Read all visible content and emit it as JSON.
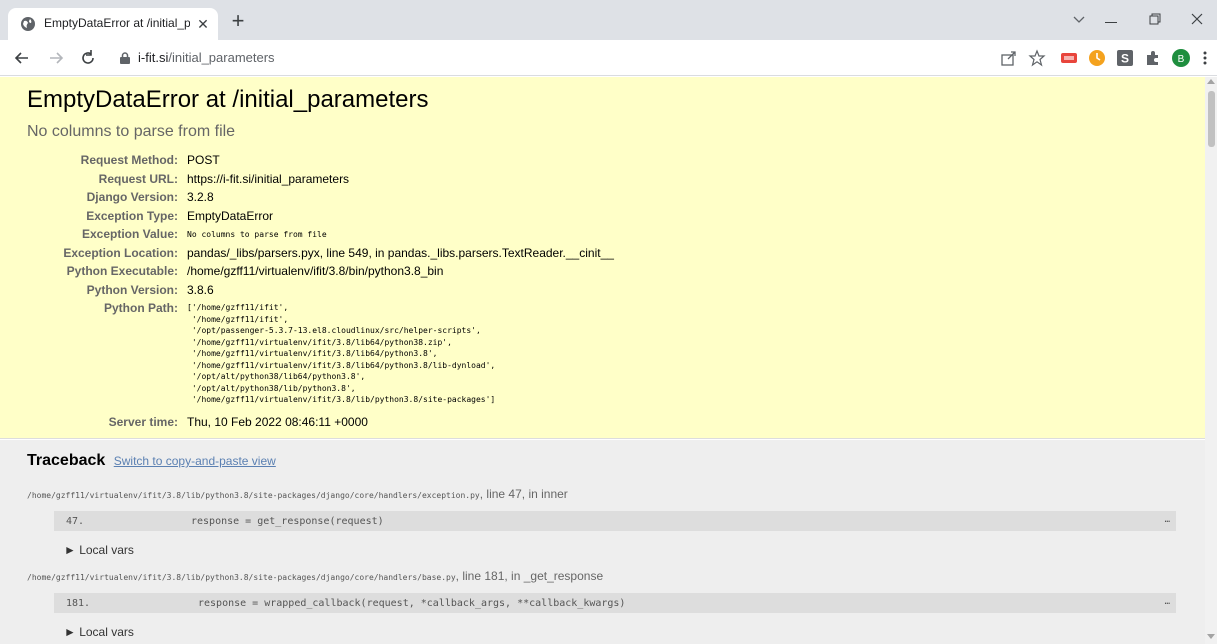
{
  "browser": {
    "tab_title": "EmptyDataError at /initial_param",
    "url_host": "i-fit.si",
    "url_path": "/initial_parameters",
    "profile_initial": "B"
  },
  "error": {
    "title": "EmptyDataError at /initial_parameters",
    "subtitle": "No columns to parse from file"
  },
  "meta": [
    {
      "key": "Request Method:",
      "value": "POST"
    },
    {
      "key": "Request URL:",
      "value": "https://i-fit.si/initial_parameters"
    },
    {
      "key": "Django Version:",
      "value": "3.2.8"
    },
    {
      "key": "Exception Type:",
      "value": "EmptyDataError"
    },
    {
      "key": "Exception Value:",
      "value": "No columns to parse from file"
    },
    {
      "key": "Exception Location:",
      "value": "pandas/_libs/parsers.pyx, line 549, in pandas._libs.parsers.TextReader.__cinit__"
    },
    {
      "key": "Python Executable:",
      "value": "/home/gzff11/virtualenv/ifit/3.8/bin/python3.8_bin"
    },
    {
      "key": "Python Version:",
      "value": "3.8.6"
    },
    {
      "key": "Python Path:",
      "value": ""
    },
    {
      "key": "Server time:",
      "value": "Thu, 10 Feb 2022 08:46:11 +0000"
    }
  ],
  "python_path": [
    "['/home/gzff11/ifit',",
    " '/home/gzff11/ifit',",
    " '/opt/passenger-5.3.7-13.el8.cloudlinux/src/helper-scripts',",
    " '/home/gzff11/virtualenv/ifit/3.8/lib64/python38.zip',",
    " '/home/gzff11/virtualenv/ifit/3.8/lib64/python3.8',",
    " '/home/gzff11/virtualenv/ifit/3.8/lib64/python3.8/lib-dynload',",
    " '/opt/alt/python38/lib64/python3.8',",
    " '/opt/alt/python38/lib/python3.8',",
    " '/home/gzff11/virtualenv/ifit/3.8/lib/python3.8/site-packages']"
  ],
  "traceback": {
    "heading": "Traceback",
    "switch_link": "Switch to copy-and-paste view",
    "frames": [
      {
        "file": "/home/gzff11/virtualenv/ifit/3.8/lib/python3.8/site-packages/django/core/handlers/exception.py",
        "location": ", line 47, in inner",
        "line_no": "47.",
        "code": "response = get_response(request)",
        "ellipsis": "…",
        "local_vars": "► Local vars"
      },
      {
        "file": "/home/gzff11/virtualenv/ifit/3.8/lib/python3.8/site-packages/django/core/handlers/base.py",
        "location": ", line 181, in _get_response",
        "line_no": "181.",
        "code": "response = wrapped_callback(request, *callback_args, **callback_kwargs)",
        "ellipsis": "…",
        "local_vars": "► Local vars"
      }
    ]
  },
  "colors": {
    "summary_bg": "#ffffc8",
    "traceback_bg": "#eeeeee",
    "link": "#5b80b2"
  }
}
